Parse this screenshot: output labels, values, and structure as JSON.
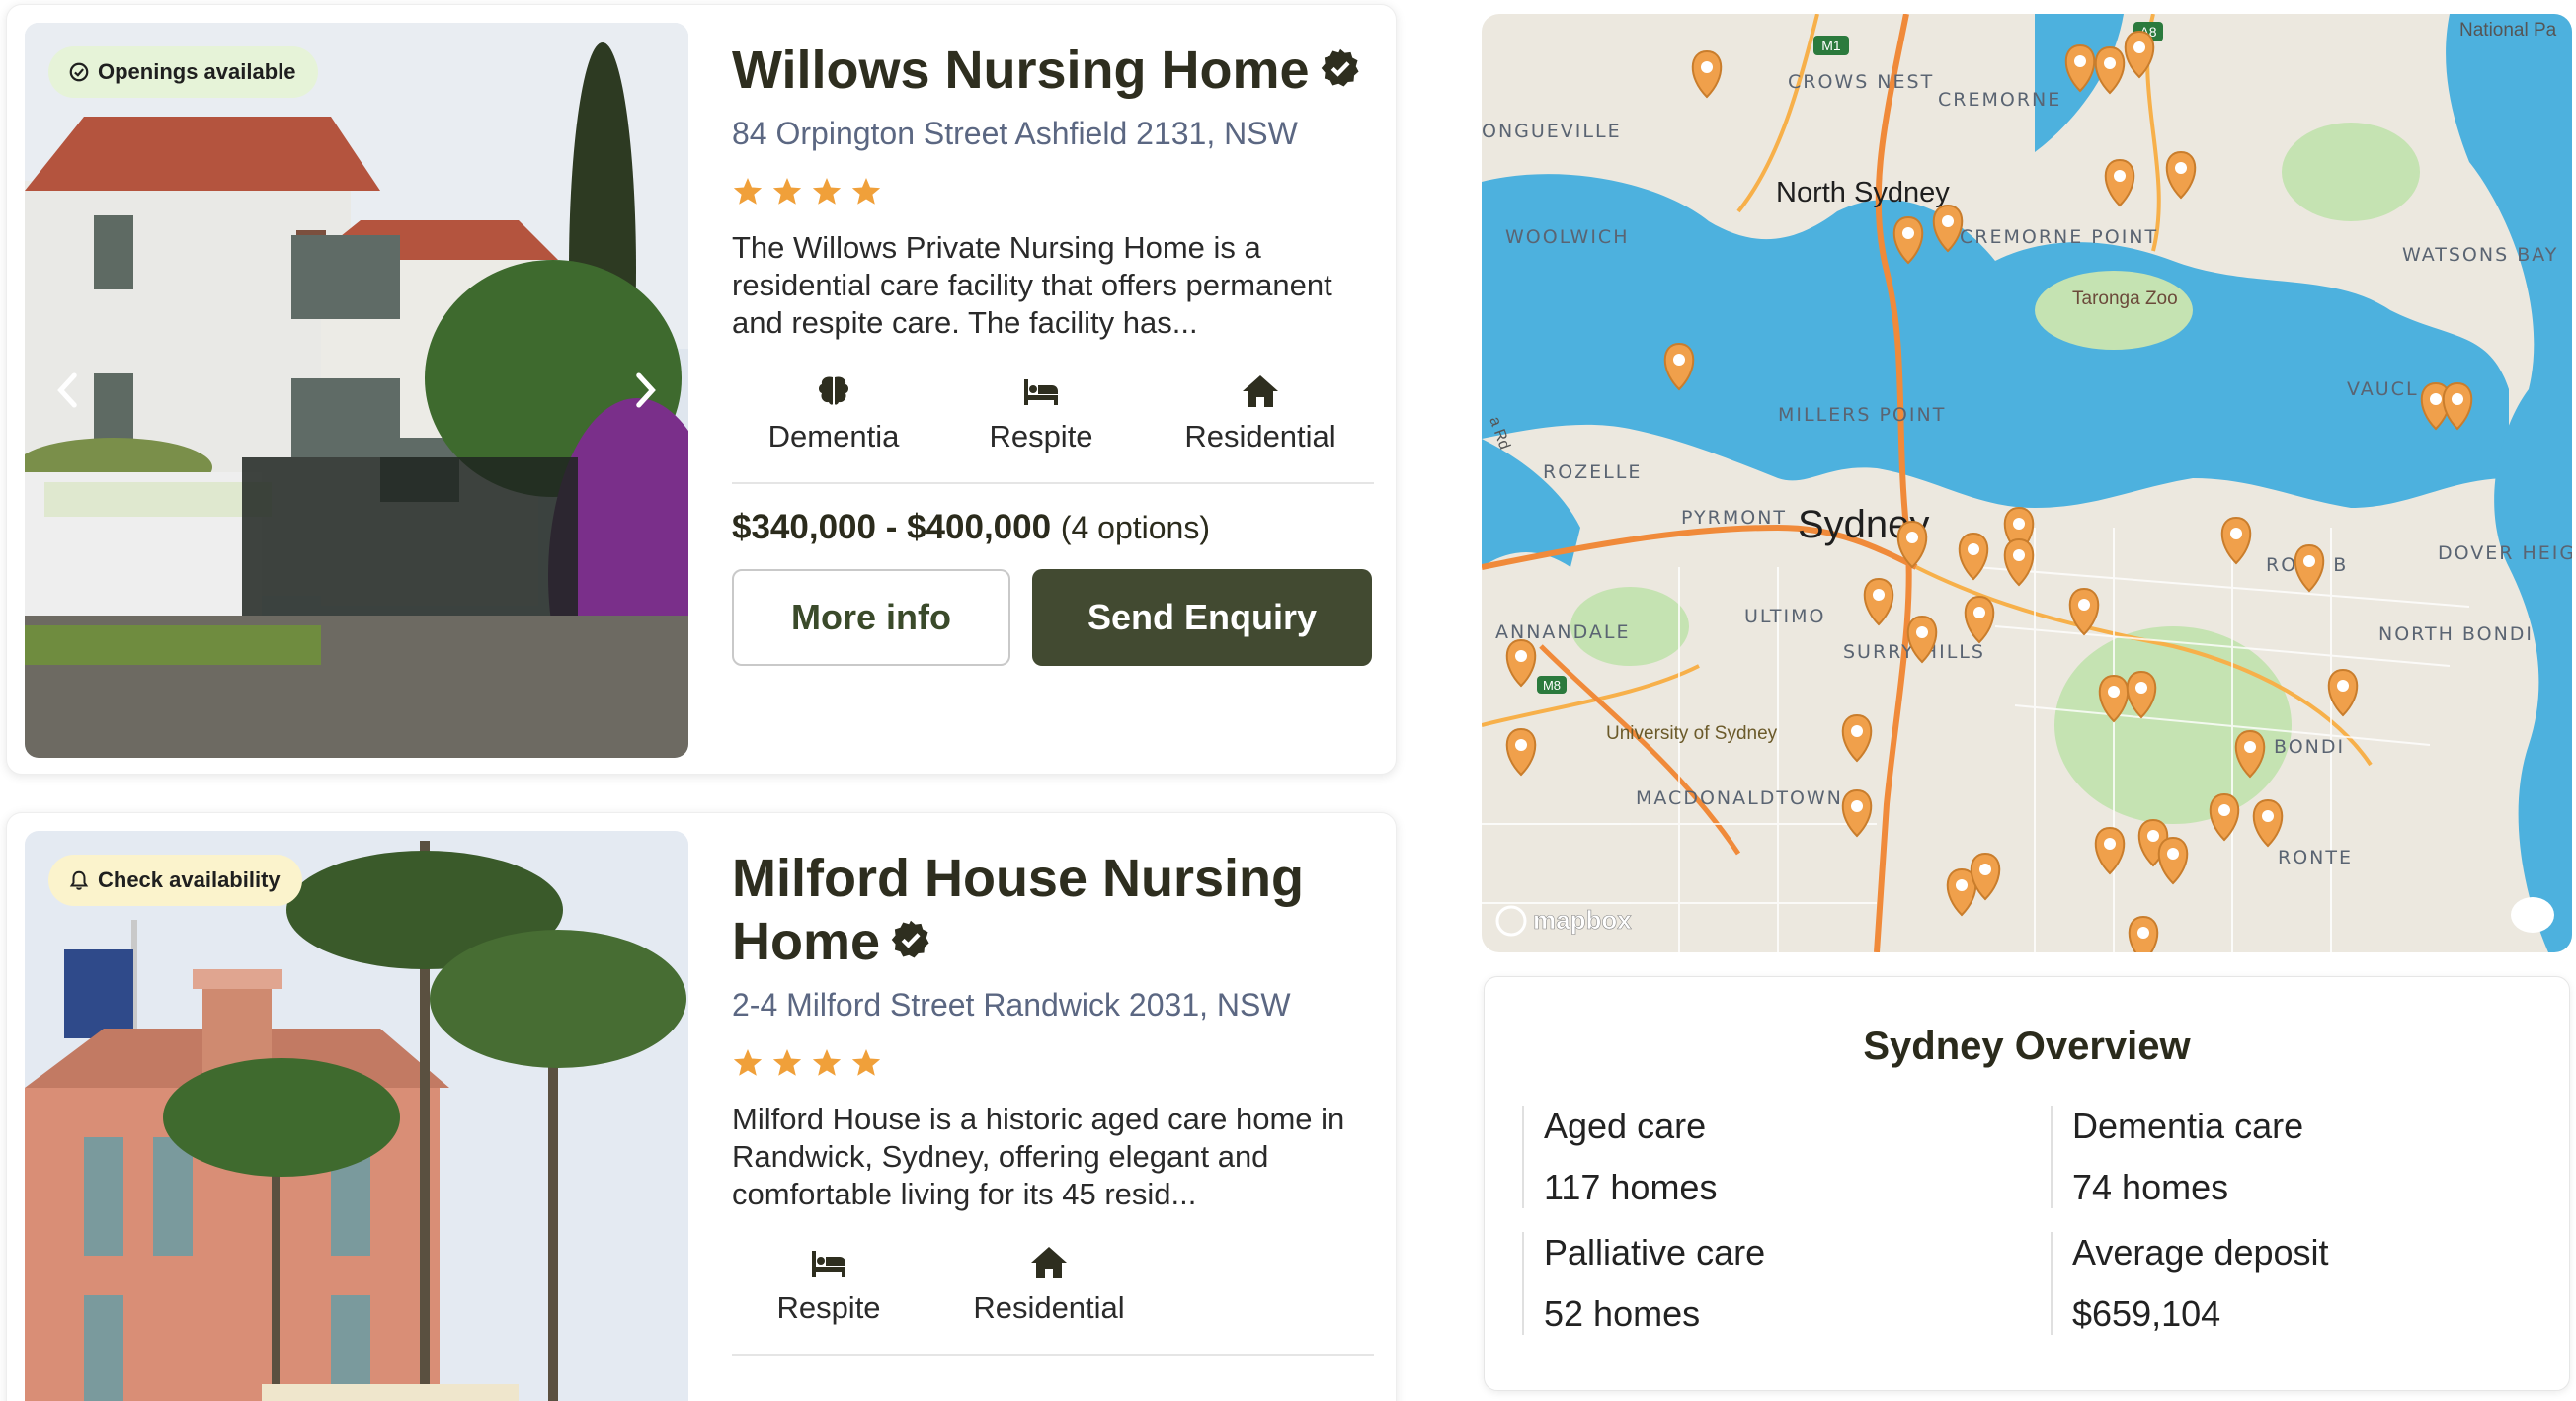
{
  "listings": [
    {
      "badge": "Openings available",
      "name": "Willows Nursing Home",
      "address": "84 Orpington Street Ashfield 2131, NSW",
      "rating": 4,
      "description": "The Willows Private Nursing Home is a residential care facility that offers permanent and respite care. The facility has...",
      "features": [
        "Dementia",
        "Respite",
        "Residential"
      ],
      "price": "$340,000 - $400,000",
      "price_options": "(4 options)",
      "more_info": "More info",
      "send_enquiry": "Send Enquiry"
    },
    {
      "badge": "Check availability",
      "name": "Milford House Nursing Home",
      "address": "2-4 Milford Street Randwick 2031, NSW",
      "rating": 4,
      "description": "Milford House is a historic aged care home in Randwick, Sydney, offering elegant and comfortable living for its 45 resid...",
      "features": [
        "Respite",
        "Residential"
      ]
    }
  ],
  "map": {
    "labels": {
      "crows_nest": "CROWS NEST",
      "cremorne": "CREMORNE",
      "longueville": "ONGUEVILLE",
      "north_sydney": "North Sydney",
      "woolwich": "WOOLWICH",
      "cremorne_point": "CREMORNE POINT",
      "taronga": "Taronga Zoo",
      "watsons_bay": "WATSONS BAY",
      "millers_point": "MILLERS POINT",
      "rozelle": "ROZELLE",
      "vaucluse": "VAUCL",
      "pyrmont": "PYRMONT",
      "sydney": "Sydney",
      "rose_bay": "ROSE B",
      "dover_heights": "DOVER HEIGHTS",
      "annandale": "ANNANDALE",
      "ultimo": "ULTIMO",
      "surry_hills": "SURRY HILLS",
      "north_bondi": "NORTH BONDI",
      "uni_sydney": "University of Sydney",
      "bondi": "BONDI",
      "macdonaldtown": "MACDONALDTOWN",
      "bronte": "RONTE",
      "national_park": "National Pa",
      "mapbox": "mapbox",
      "m1": "M1",
      "a8": "A8",
      "m8": "M8",
      "victoria_rd": "a Rd"
    },
    "marker_color": "#f0a04b"
  },
  "overview": {
    "title": "Sydney Overview",
    "stats": [
      {
        "label": "Aged care",
        "value": "117 homes"
      },
      {
        "label": "Dementia care",
        "value": "74 homes"
      },
      {
        "label": "Palliative care",
        "value": "52 homes"
      },
      {
        "label": "Average deposit",
        "value": "$659,104"
      }
    ]
  }
}
